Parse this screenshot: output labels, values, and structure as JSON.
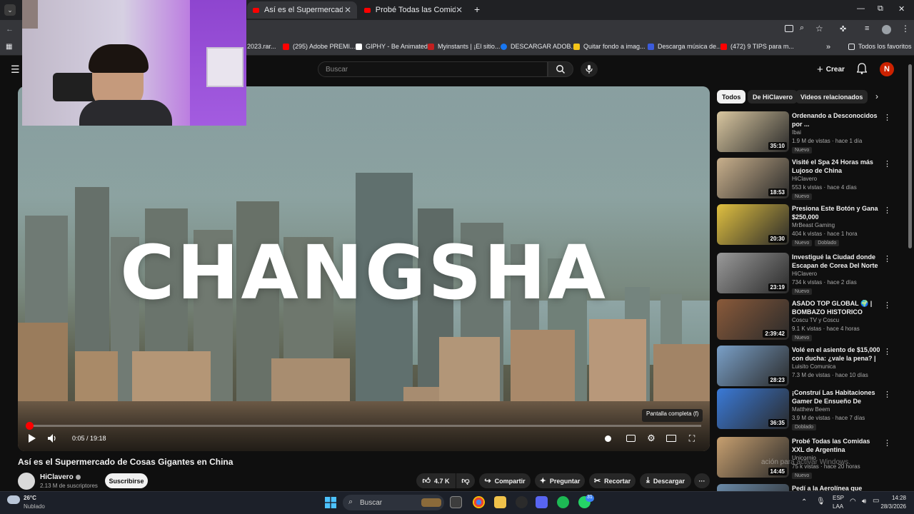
{
  "browser": {
    "tabs": [
      {
        "title": "Así es el Supermercado de Cos",
        "active": true
      },
      {
        "title": "Probé Todas las Comidas XXL d",
        "active": false
      }
    ],
    "new_tab": "+",
    "bookmarks": [
      {
        "label": "2023.rar...",
        "color": "#444"
      },
      {
        "label": "(295) Adobe PREMI...",
        "color": "#ff0000"
      },
      {
        "label": "GIPHY - Be Animated",
        "color": "#ffffff"
      },
      {
        "label": "Myinstants | ¡El sitio...",
        "color": "#c21f1f"
      },
      {
        "label": "DESCARGAR ADOB...",
        "color": "#1877f2"
      },
      {
        "label": "Quitar fondo a imag...",
        "color": "#f5c518"
      },
      {
        "label": "Descarga música de...",
        "color": "#3b5bdb"
      },
      {
        "label": "(472) 9 TIPS para m...",
        "color": "#ff0000"
      }
    ],
    "all_favorites": "Todos los favoritos"
  },
  "header": {
    "search_placeholder": "Buscar",
    "create_label": "Crear",
    "avatar_letter": "N"
  },
  "video": {
    "overlay_title": "CHANGSHA",
    "time": "0:05 / 19:18",
    "progress_fraction": 0.0043,
    "fullscreen_tooltip": "Pantalla completa (f)",
    "title": "Así es el Supermercado de Cosas Gigantes en China",
    "channel": "HiClavero",
    "subscribers": "2.13 M de suscriptores",
    "subscribe_label": "Suscribirse",
    "actions": {
      "likes": "4.7 K",
      "share": "Compartir",
      "ask": "Preguntar",
      "clip": "Recortar",
      "download": "Descargar"
    }
  },
  "sidebar": {
    "chips": [
      "Todos",
      "De HiClavero",
      "Videos relacionados"
    ],
    "recommendations": [
      {
        "title": "Ordenando a Desconocidos por ...",
        "channel": "Ibai",
        "meta": "1.9 M de vistas · hace 1 día",
        "badges": [
          "Nuevo"
        ],
        "duration": "35:10",
        "thumb": "#d9c7a0"
      },
      {
        "title": "Visité el Spa 24 Horas más Lujoso de China",
        "channel": "HiClavero",
        "meta": "553 k vistas · hace 4 días",
        "badges": [
          "Nuevo"
        ],
        "duration": "18:53",
        "thumb": "#c9b08c"
      },
      {
        "title": "Presiona Este Botón y Gana $250,000",
        "channel": "MrBeast Gaming",
        "meta": "404 k vistas · hace 1 hora",
        "badges": [
          "Nuevo",
          "Doblado"
        ],
        "duration": "20:30",
        "thumb": "#e0c040"
      },
      {
        "title": "Investigué la Ciudad donde Escapan de Corea Del Norte",
        "channel": "HiClavero",
        "meta": "734 k vistas · hace 2 días",
        "badges": [
          "Nuevo"
        ],
        "duration": "23:19",
        "thumb": "#9a9a9a"
      },
      {
        "title": "ASADO TOP GLOBAL 🌍 | BOMBAZO HISTORICO",
        "channel": "Coscu TV y Coscu",
        "meta": "9.1 K vistas · hace 4 horas",
        "badges": [
          "Nuevo"
        ],
        "duration": "2:39:42",
        "thumb": "#8a5a3a"
      },
      {
        "title": "Volé en el asiento de $15,000 con ducha: ¿vale la pena? | ...",
        "channel": "Luisito Comunica",
        "meta": "7.3 M de vistas · hace 10 días",
        "badges": [],
        "duration": "28:23",
        "thumb": "#7aa0c8"
      },
      {
        "title": "¡Construí Las Habitaciones Gamer De Ensueño De MrBeas...",
        "channel": "Matthew Beem",
        "meta": "3.9 M de vistas · hace 7 días",
        "badges": [
          "Doblado"
        ],
        "duration": "36:35",
        "thumb": "#3a7ad8"
      },
      {
        "title": "Probé Todas las Comidas XXL de Argentina",
        "channel": "Unicornio",
        "meta": "75 k vistas · hace 20 horas",
        "badges": [
          "Nuevo"
        ],
        "duration": "14:45",
        "thumb": "#c8a070"
      },
      {
        "title": "Pedí a la Aerolínea que",
        "channel": "",
        "meta": "",
        "badges": [],
        "duration": "",
        "thumb": "#6a8aa8"
      }
    ]
  },
  "watermark": "ación para activar Windows.",
  "taskbar": {
    "weather_temp": "26°C",
    "weather_desc": "Nublado",
    "search_label": "Buscar",
    "lang_top": "ESP",
    "lang_bottom": "LAA",
    "time": "14:28",
    "date": "28/3/2026",
    "notif_count": "31"
  }
}
